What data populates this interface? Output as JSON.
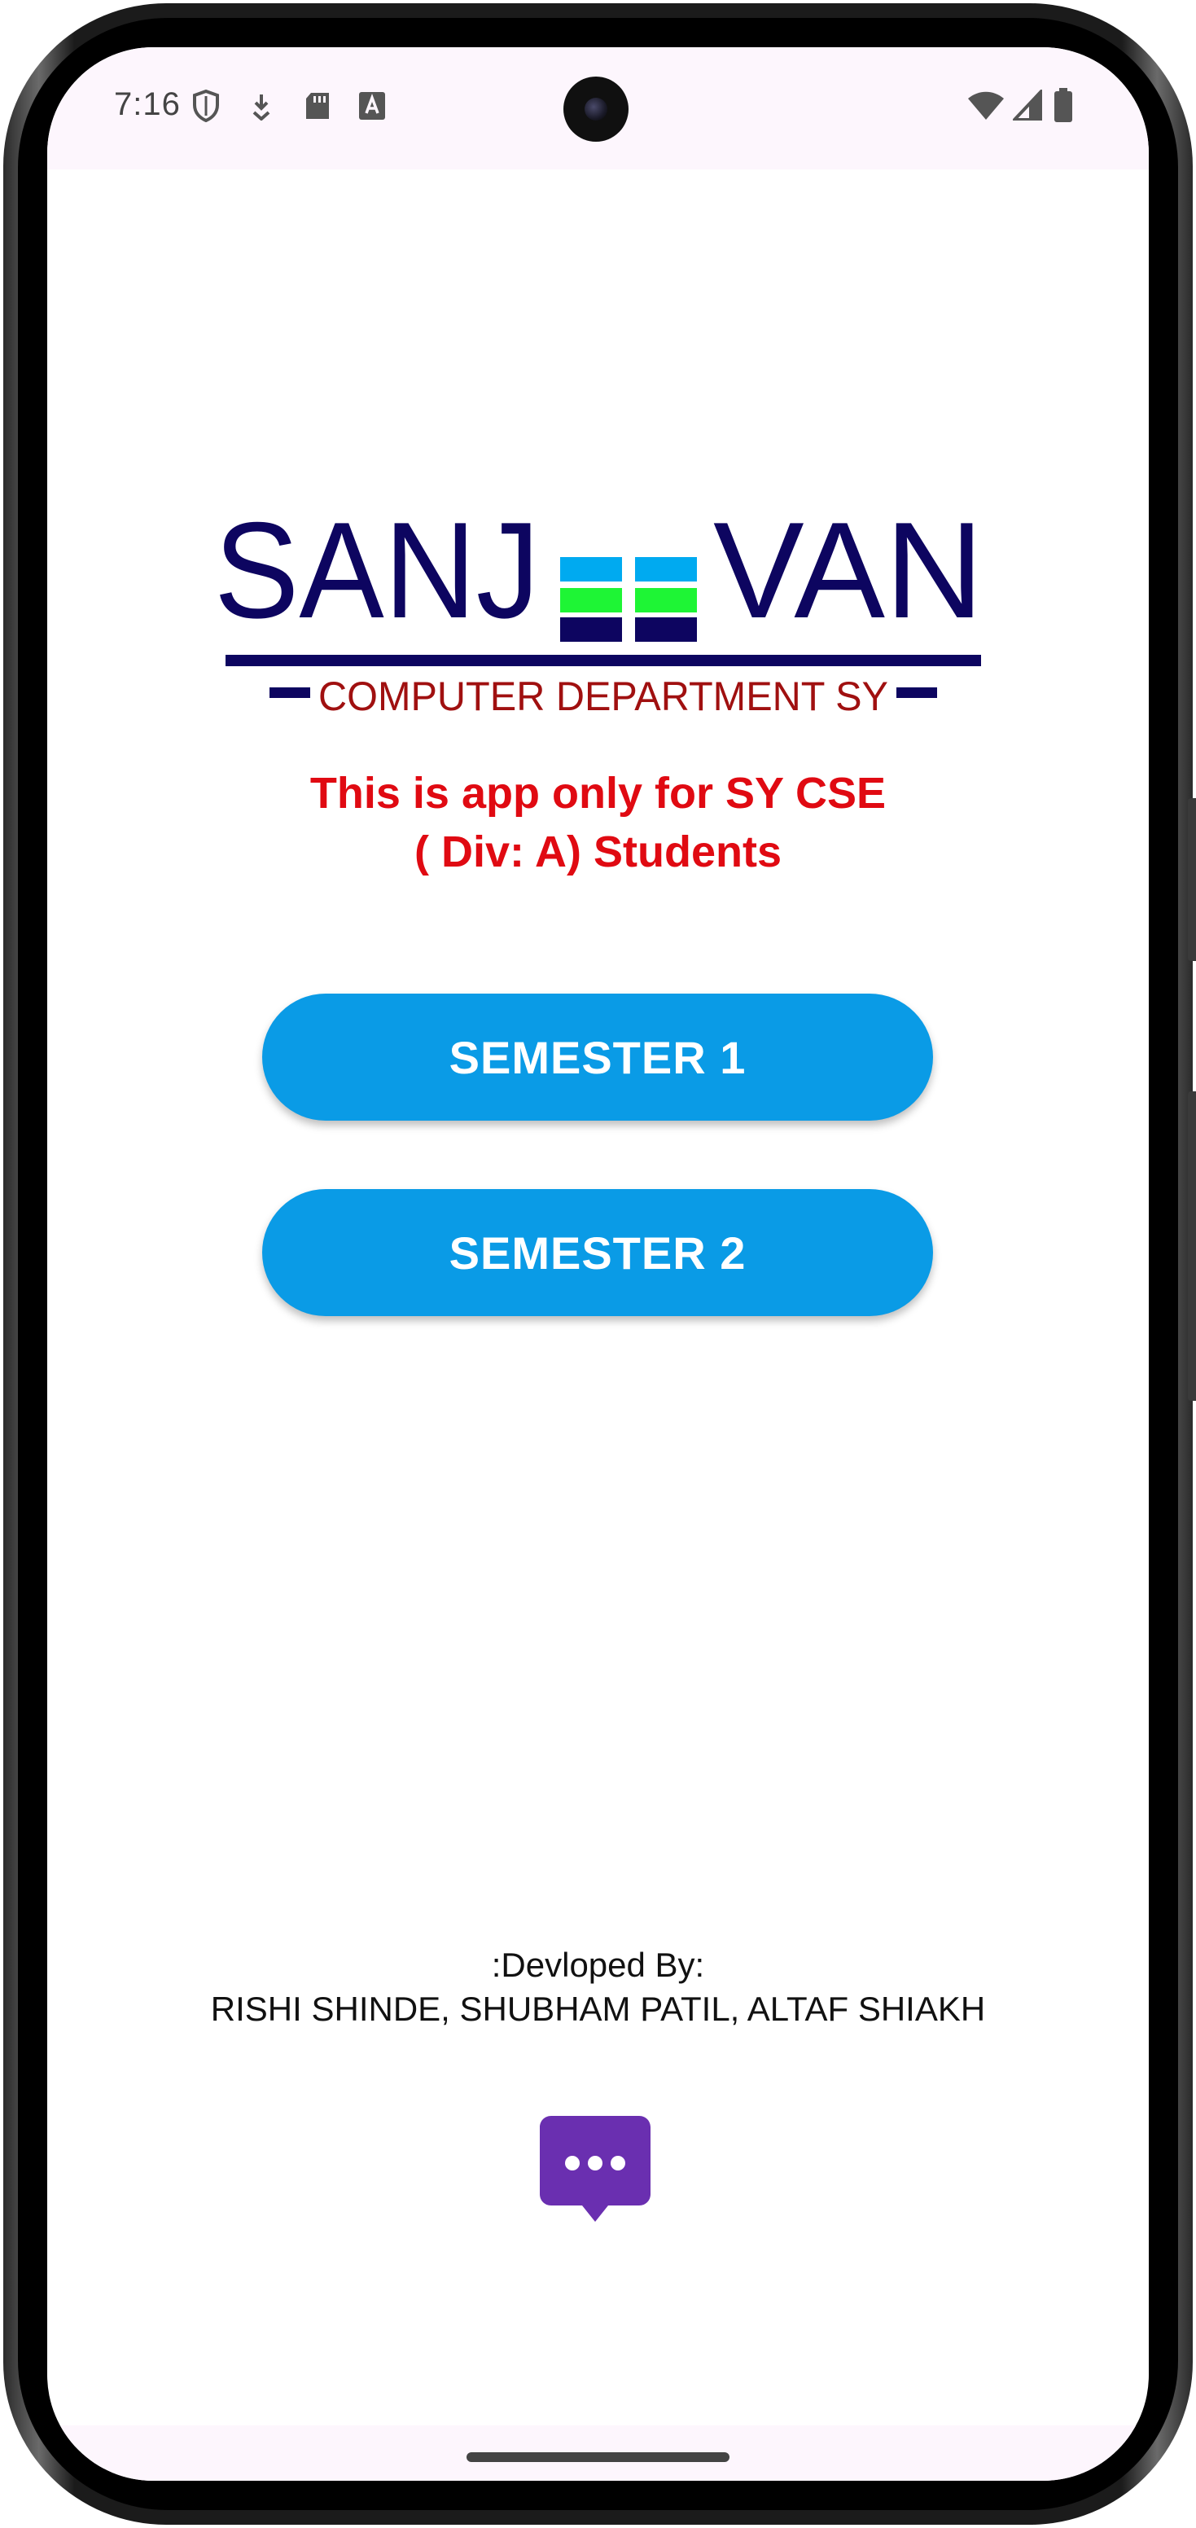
{
  "status_bar": {
    "time": "7:16",
    "left_icons": [
      "shield-icon",
      "download-icon",
      "sd-card-icon",
      "keyboard-a-icon"
    ],
    "right_icons": [
      "wifi-icon",
      "signal-icon",
      "battery-icon"
    ]
  },
  "logo": {
    "text_left": "SANJ",
    "text_right": "VAN",
    "subtitle": "COMPUTER DEPARTMENT SY",
    "colors": {
      "navy": "#0d0560",
      "cyan": "#00aaf0",
      "green": "#1ef535",
      "red": "#a01010"
    }
  },
  "info": {
    "line1": "This is app only for SY CSE",
    "line2": "( Div: A) Students",
    "color": "#e00a12"
  },
  "buttons": {
    "semester1": "SEMESTER 1",
    "semester2": "SEMESTER 2",
    "color": "#0a9be6"
  },
  "credits": {
    "heading": ":Devloped By:",
    "names": "RISHI SHINDE,  SHUBHAM PATIL,  ALTAF SHIAKH"
  },
  "chat_fab": {
    "icon": "chat-bubble-icon",
    "color": "#6a2fb0"
  }
}
